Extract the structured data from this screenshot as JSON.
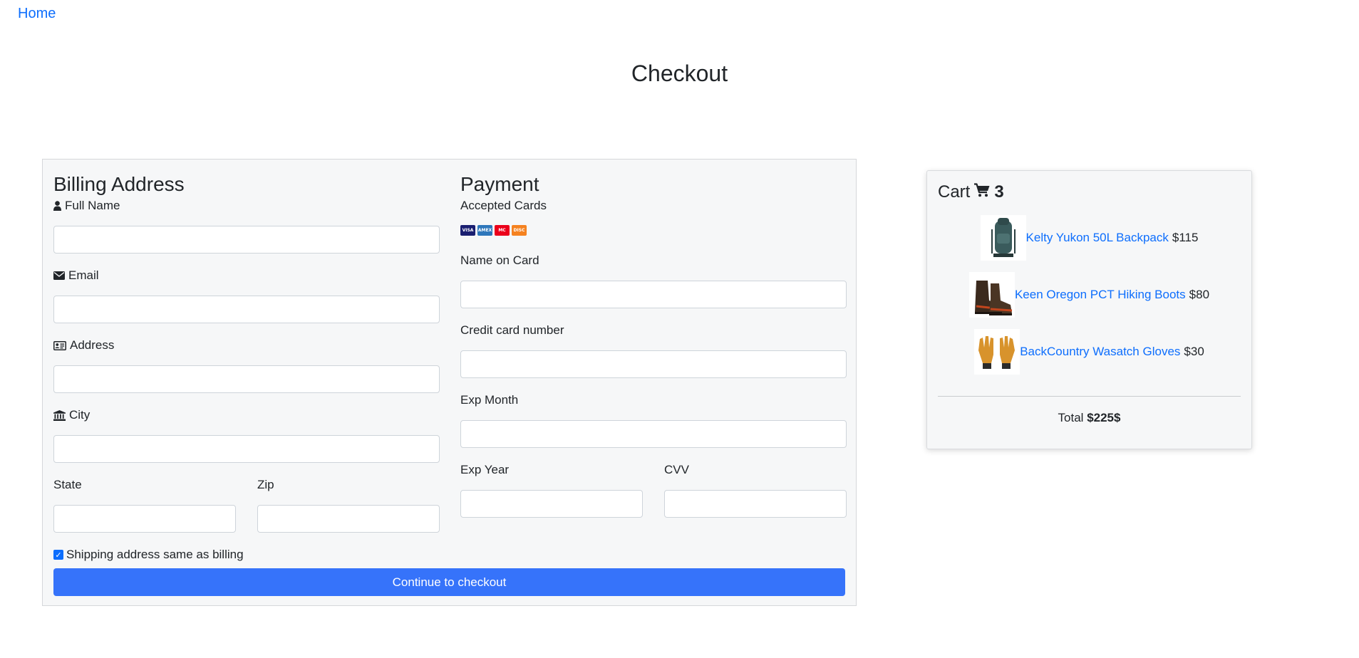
{
  "nav": {
    "home": "Home"
  },
  "page": {
    "title": "Checkout"
  },
  "billing": {
    "title": "Billing Address",
    "full_name_label": "Full Name",
    "email_label": "Email",
    "address_label": "Address",
    "city_label": "City",
    "state_label": "State",
    "zip_label": "Zip",
    "full_name_value": "",
    "email_value": "",
    "address_value": "",
    "city_value": "",
    "state_value": "",
    "zip_value": "",
    "same_shipping_label": "Shipping address same as billing",
    "same_shipping_checked": true
  },
  "payment": {
    "title": "Payment",
    "accepted_cards_label": "Accepted Cards",
    "cards": [
      {
        "name": "VISA",
        "color": "#1a1f71"
      },
      {
        "name": "AMEX",
        "color": "#2e77bb"
      },
      {
        "name": "MC",
        "color": "#eb001b"
      },
      {
        "name": "DISC",
        "color": "#f58220"
      }
    ],
    "name_on_card_label": "Name on Card",
    "card_number_label": "Credit card number",
    "exp_month_label": "Exp Month",
    "exp_year_label": "Exp Year",
    "cvv_label": "CVV",
    "name_on_card_value": "",
    "card_number_value": "",
    "exp_month_value": "",
    "exp_year_value": "",
    "cvv_value": ""
  },
  "submit": {
    "label": "Continue to checkout"
  },
  "cart": {
    "title": "Cart",
    "count": "3",
    "items": [
      {
        "name": "Kelty Yukon 50L Backpack",
        "price": "$115"
      },
      {
        "name": "Keen Oregon PCT Hiking Boots",
        "price": "$80"
      },
      {
        "name": "BackCountry Wasatch Gloves",
        "price": "$30"
      }
    ],
    "total_label": "Total",
    "total_value": "$225$"
  },
  "colors": {
    "primary": "#0d6efd",
    "button": "#3673fa",
    "card_bg": "#f6f7f8"
  },
  "icons": [
    "user-icon",
    "envelope-icon",
    "address-card-icon",
    "institution-icon",
    "shopping-cart-icon"
  ]
}
